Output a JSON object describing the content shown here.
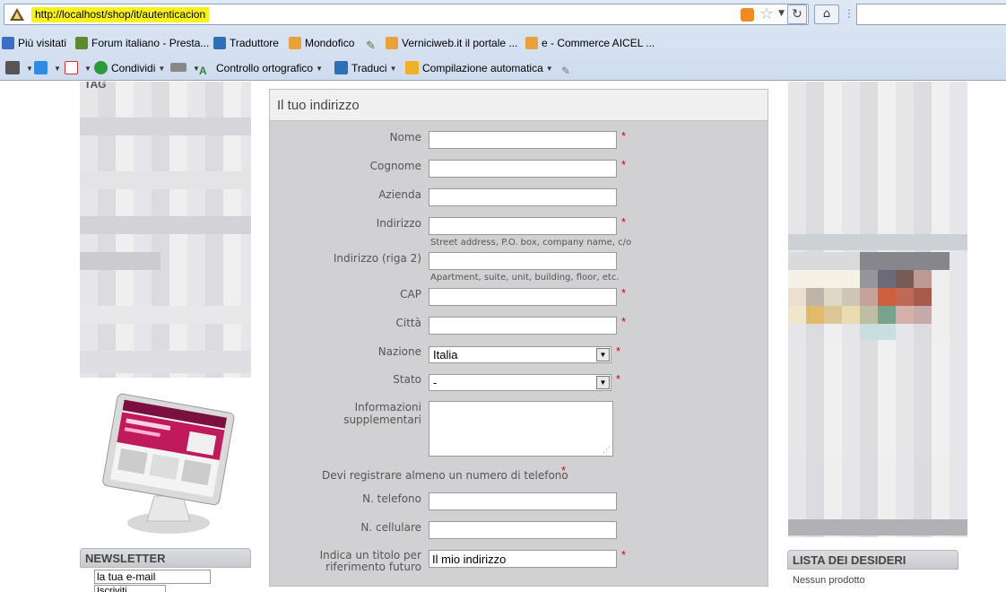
{
  "browser": {
    "url": "http://localhost/shop/it/autenticacion",
    "search_value": ""
  },
  "bookmarks": [
    {
      "label": "Più visitati",
      "icon": "globe-icon",
      "color": "#3a6fc4"
    },
    {
      "label": "Forum italiano - Presta...",
      "icon": "prestashop-icon",
      "color": "#5c8a2e"
    },
    {
      "label": "Traduttore",
      "icon": "translate-icon",
      "color": "#2f6fb8"
    },
    {
      "label": "Mondofico",
      "icon": "rss-icon",
      "color": "#e9a23b"
    },
    {
      "label": "Verniciweb.it il portale ...",
      "icon": "rss-icon",
      "color": "#e9a23b"
    },
    {
      "label": "e - Commerce  AICEL ...",
      "icon": "rss-icon",
      "color": "#e9a23b"
    }
  ],
  "toolbar": {
    "share_label": "Condividi",
    "spellcheck_label": "Controllo ortografico",
    "translate_label": "Traduci",
    "autofill_label": "Compilazione automatica"
  },
  "left_column": {
    "block_title": "TAG",
    "newsletter_title": "NEWSLETTER",
    "newsletter_input": "la tua e-mail",
    "newsletter_button": "Iscriviti"
  },
  "right_column": {
    "wishlist_title": "LISTA DEI DESIDERI",
    "wishlist_empty": "Nessun prodotto"
  },
  "form": {
    "title": "Il tuo indirizzo",
    "required_mark": "*",
    "fields": {
      "nome": {
        "label": "Nome",
        "value": ""
      },
      "cognome": {
        "label": "Cognome",
        "value": ""
      },
      "azienda": {
        "label": "Azienda",
        "value": ""
      },
      "indirizzo": {
        "label": "Indirizzo",
        "value": "",
        "hint": "Street address, P.O. box, company name, c/o"
      },
      "indirizzo2": {
        "label": "Indirizzo (riga 2)",
        "value": "",
        "hint": "Apartment, suite, unit, building, floor, etc."
      },
      "cap": {
        "label": "CAP",
        "value": ""
      },
      "citta": {
        "label": "Città",
        "value": ""
      },
      "nazione": {
        "label": "Nazione",
        "value": "Italia"
      },
      "stato": {
        "label": "Stato",
        "value": "-"
      },
      "info": {
        "label": "Informazioni supplementari",
        "value": ""
      },
      "telefono": {
        "label": "N. telefono",
        "value": ""
      },
      "cellulare": {
        "label": "N. cellulare",
        "value": ""
      },
      "alias": {
        "label_line1": "Indica un titolo per",
        "label_line2": "riferimento futuro",
        "value": "Il mio indirizzo"
      }
    },
    "phone_note": "Devi registrare almeno un numero di telefono"
  }
}
